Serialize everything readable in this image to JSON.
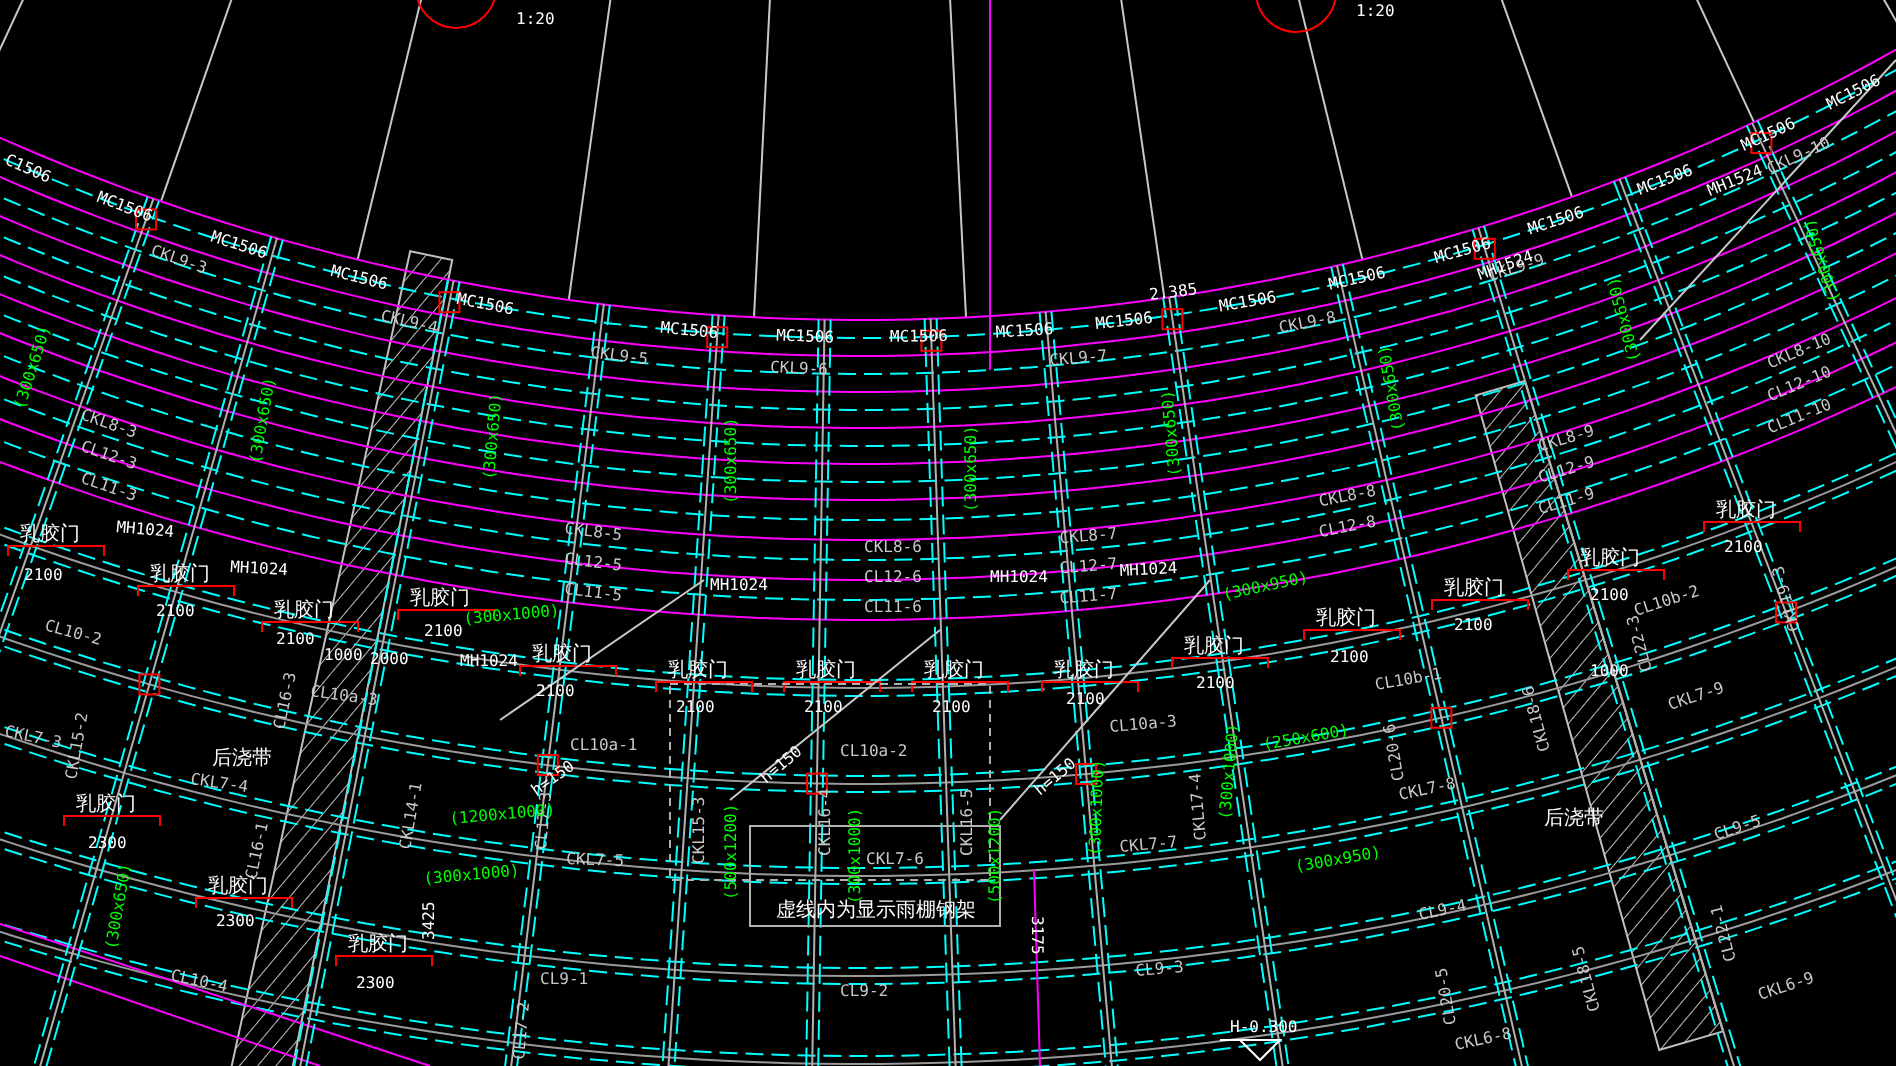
{
  "labels": [
    {
      "kind": "scale",
      "text": "1:20"
    },
    {
      "kind": "scale",
      "text": "1:20"
    },
    {
      "kind": "door_mark",
      "text": "C1506"
    },
    {
      "kind": "door_mark",
      "text": "MC1506"
    },
    {
      "kind": "door_mark",
      "text": "MC1506"
    },
    {
      "kind": "door_mark",
      "text": "MC1506"
    },
    {
      "kind": "door_mark",
      "text": "MC1506"
    },
    {
      "kind": "door_mark",
      "text": "MC1506"
    },
    {
      "kind": "door_mark",
      "text": "MC1506"
    },
    {
      "kind": "door_mark",
      "text": "MC1506"
    },
    {
      "kind": "door_mark",
      "text": "MC1506"
    },
    {
      "kind": "door_mark",
      "text": "MC1506"
    },
    {
      "kind": "door_mark",
      "text": "MC1506"
    },
    {
      "kind": "door_mark",
      "text": "MC1506"
    },
    {
      "kind": "door_mark",
      "text": "MC1506"
    },
    {
      "kind": "door_mark",
      "text": "MC1506"
    },
    {
      "kind": "door_mark",
      "text": "MC1506"
    },
    {
      "kind": "door_mark",
      "text": "MC1506"
    },
    {
      "kind": "door_mark",
      "text": "MC1506"
    },
    {
      "kind": "dimension",
      "text": "2.385"
    },
    {
      "kind": "beam",
      "text": "CKL9-3"
    },
    {
      "kind": "beam",
      "text": "CKL9-4"
    },
    {
      "kind": "beam",
      "text": "CKL9-5"
    },
    {
      "kind": "beam",
      "text": "CKL9-6"
    },
    {
      "kind": "beam",
      "text": "CKL9-7"
    },
    {
      "kind": "beam",
      "text": "CKL9-8"
    },
    {
      "kind": "beam",
      "text": "CKL9-9"
    },
    {
      "kind": "beam",
      "text": "CKL9-10"
    },
    {
      "kind": "beam",
      "text": "CKL8-3"
    },
    {
      "kind": "beam",
      "text": "CL12-3"
    },
    {
      "kind": "beam",
      "text": "CL11-3"
    },
    {
      "kind": "beam",
      "text": "CKL8-5"
    },
    {
      "kind": "beam",
      "text": "CL12-5"
    },
    {
      "kind": "beam",
      "text": "CL11-5"
    },
    {
      "kind": "beam",
      "text": "CKL8-6"
    },
    {
      "kind": "beam",
      "text": "CL12-6"
    },
    {
      "kind": "beam",
      "text": "CL11-6"
    },
    {
      "kind": "beam",
      "text": "CKL8-7"
    },
    {
      "kind": "beam",
      "text": "CL12-7"
    },
    {
      "kind": "beam",
      "text": "CL11-7"
    },
    {
      "kind": "beam",
      "text": "CKL8-8"
    },
    {
      "kind": "beam",
      "text": "CL12-8"
    },
    {
      "kind": "beam",
      "text": "CKL8-9"
    },
    {
      "kind": "beam",
      "text": "CL12-9"
    },
    {
      "kind": "beam",
      "text": "CL11-9"
    },
    {
      "kind": "beam",
      "text": "CKL8-10"
    },
    {
      "kind": "beam",
      "text": "CL12-10"
    },
    {
      "kind": "beam",
      "text": "CL11-10"
    },
    {
      "kind": "door",
      "text": "乳胶门"
    },
    {
      "kind": "door",
      "text": "乳胶门"
    },
    {
      "kind": "door",
      "text": "乳胶门"
    },
    {
      "kind": "door",
      "text": "乳胶门"
    },
    {
      "kind": "door",
      "text": "乳胶门"
    },
    {
      "kind": "door",
      "text": "乳胶门"
    },
    {
      "kind": "door",
      "text": "乳胶门"
    },
    {
      "kind": "door",
      "text": "乳胶门"
    },
    {
      "kind": "door",
      "text": "乳胶门"
    },
    {
      "kind": "door",
      "text": "乳胶门"
    },
    {
      "kind": "door",
      "text": "乳胶门"
    },
    {
      "kind": "door",
      "text": "乳胶门"
    },
    {
      "kind": "door",
      "text": "乳胶门"
    },
    {
      "kind": "door",
      "text": "乳胶门"
    },
    {
      "kind": "door",
      "text": "乳胶门"
    },
    {
      "kind": "door",
      "text": "乳胶门"
    },
    {
      "kind": "door",
      "text": "乳胶门"
    },
    {
      "kind": "width",
      "text": "2100"
    },
    {
      "kind": "width",
      "text": "2100"
    },
    {
      "kind": "width",
      "text": "2100"
    },
    {
      "kind": "width",
      "text": "2100"
    },
    {
      "kind": "width",
      "text": "2100"
    },
    {
      "kind": "width",
      "text": "2100"
    },
    {
      "kind": "width",
      "text": "2100"
    },
    {
      "kind": "width",
      "text": "2100"
    },
    {
      "kind": "width",
      "text": "2100"
    },
    {
      "kind": "width",
      "text": "2100"
    },
    {
      "kind": "width",
      "text": "2100"
    },
    {
      "kind": "width",
      "text": "2100"
    },
    {
      "kind": "width",
      "text": "2100"
    },
    {
      "kind": "width",
      "text": "2100"
    },
    {
      "kind": "width",
      "text": "2300"
    },
    {
      "kind": "width",
      "text": "2300"
    },
    {
      "kind": "width",
      "text": "2300"
    },
    {
      "kind": "door_mark",
      "text": "MH1024"
    },
    {
      "kind": "door_mark",
      "text": "MH1024"
    },
    {
      "kind": "door_mark",
      "text": "MH1024"
    },
    {
      "kind": "door_mark",
      "text": "MH1024"
    },
    {
      "kind": "door_mark",
      "text": "MH1024"
    },
    {
      "kind": "door_mark",
      "text": "MH1024"
    },
    {
      "kind": "door_mark",
      "text": "MH1524"
    },
    {
      "kind": "door_mark",
      "text": "MH1524"
    },
    {
      "kind": "note",
      "text": "后浇带"
    },
    {
      "kind": "note",
      "text": "后浇带"
    },
    {
      "kind": "note",
      "text": "虚线内为显示雨棚钢架"
    },
    {
      "kind": "dimension",
      "text": "h=150"
    },
    {
      "kind": "dimension",
      "text": "h=150"
    },
    {
      "kind": "dimension",
      "text": "h=150"
    },
    {
      "kind": "level",
      "text": "H-0.300"
    },
    {
      "kind": "dimension",
      "text": "3175"
    },
    {
      "kind": "dimension",
      "text": "3425"
    },
    {
      "kind": "dimension",
      "text": "1000"
    },
    {
      "kind": "dimension",
      "text": "2000"
    },
    {
      "kind": "dimension",
      "text": "1000"
    },
    {
      "kind": "beam",
      "text": "CL10-2"
    },
    {
      "kind": "beam",
      "text": "CL10a-3"
    },
    {
      "kind": "beam",
      "text": "CL10a-1"
    },
    {
      "kind": "beam",
      "text": "CL10a-2"
    },
    {
      "kind": "beam",
      "text": "CL10a-3"
    },
    {
      "kind": "beam",
      "text": "CL10b-1"
    },
    {
      "kind": "beam",
      "text": "CL10b-2"
    },
    {
      "kind": "beam",
      "text": "CKL7-3"
    },
    {
      "kind": "beam",
      "text": "CKL7-4"
    },
    {
      "kind": "beam",
      "text": "CKL7-5"
    },
    {
      "kind": "beam",
      "text": "CKL7-6"
    },
    {
      "kind": "beam",
      "text": "CKL7-7"
    },
    {
      "kind": "beam",
      "text": "CKL7-8"
    },
    {
      "kind": "beam",
      "text": "CKL7-9"
    },
    {
      "kind": "beam",
      "text": "CL9-1"
    },
    {
      "kind": "beam",
      "text": "CL9-2"
    },
    {
      "kind": "beam",
      "text": "CL9-3"
    },
    {
      "kind": "beam",
      "text": "CL9-4"
    },
    {
      "kind": "beam",
      "text": "CL9-5"
    },
    {
      "kind": "beam",
      "text": "CL10-4"
    },
    {
      "kind": "beam",
      "text": "CKL6-8"
    },
    {
      "kind": "beam",
      "text": "CKL6-9"
    },
    {
      "kind": "beam",
      "text": "CKL15-3"
    },
    {
      "kind": "beam",
      "text": "CKL16-4"
    },
    {
      "kind": "beam",
      "text": "CKL16-5"
    },
    {
      "kind": "beam",
      "text": "CKL15-2"
    },
    {
      "kind": "beam",
      "text": "CL16-3"
    },
    {
      "kind": "beam",
      "text": "CL16-1"
    },
    {
      "kind": "beam",
      "text": "CKL14-1"
    },
    {
      "kind": "beam",
      "text": "CL17-3"
    },
    {
      "kind": "beam",
      "text": "CL17-2"
    },
    {
      "kind": "beam",
      "text": "CKL17-4"
    },
    {
      "kind": "beam",
      "text": "CL20-6"
    },
    {
      "kind": "beam",
      "text": "CKL18-6"
    },
    {
      "kind": "beam",
      "text": "CL22-3"
    },
    {
      "kind": "beam",
      "text": "CKL19-3"
    },
    {
      "kind": "beam",
      "text": "CL22-1"
    },
    {
      "kind": "beam",
      "text": "CKL18-5"
    },
    {
      "kind": "beam",
      "text": "CL20-5"
    },
    {
      "kind": "size",
      "text": "(300x1000)"
    },
    {
      "kind": "size",
      "text": "(300x950)"
    },
    {
      "kind": "size",
      "text": "(250x600)"
    },
    {
      "kind": "size",
      "text": "(300x950)"
    },
    {
      "kind": "size",
      "text": "(1200x1000)"
    },
    {
      "kind": "size",
      "text": "(300x1000)"
    },
    {
      "kind": "size",
      "text": "(500x1200)"
    },
    {
      "kind": "size",
      "text": "(300x1000)"
    },
    {
      "kind": "size",
      "text": "(500x1200)"
    },
    {
      "kind": "size",
      "text": "(300x1000)"
    },
    {
      "kind": "size",
      "text": "(300x1000)"
    },
    {
      "kind": "size",
      "text": "(300x650)"
    },
    {
      "kind": "size",
      "text": "(300x650)"
    },
    {
      "kind": "size",
      "text": "(300x650)"
    },
    {
      "kind": "size",
      "text": "(300x650)"
    },
    {
      "kind": "size",
      "text": "(300x650)"
    },
    {
      "kind": "size",
      "text": "(300x650)"
    },
    {
      "kind": "size",
      "text": "(300x650)"
    },
    {
      "kind": "size",
      "text": "(300x650)"
    },
    {
      "kind": "size",
      "text": "(300x650)"
    },
    {
      "kind": "size",
      "text": "(300x650)"
    }
  ]
}
